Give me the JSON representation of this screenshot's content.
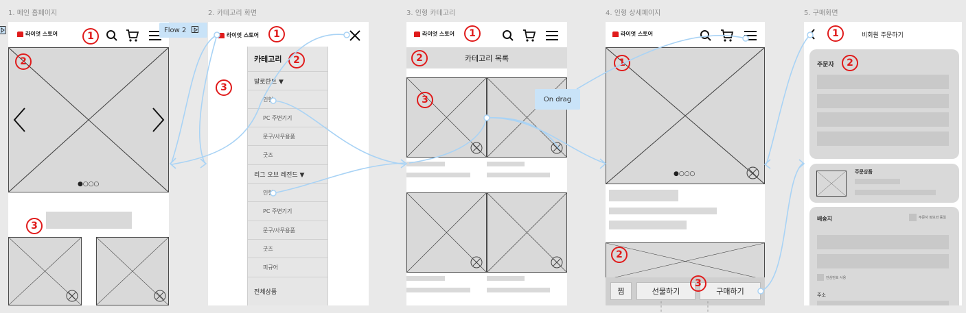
{
  "frames": [
    {
      "title": "1. 메인 홈페이지"
    },
    {
      "title": "2. 카테고리 화면"
    },
    {
      "title": "3. 인형 카테고리"
    },
    {
      "title": "4. 인형 상세페이지"
    },
    {
      "title": "5. 구매화면"
    }
  ],
  "brand": {
    "logo_text": "라이엇 스토어",
    "accent": "#e01b1b",
    "flow_color": "#a9d3f5"
  },
  "flow_label": "Flow 2",
  "drag_label": "On drag",
  "badges": [
    "1",
    "2",
    "3"
  ],
  "category_menu": {
    "header": "카테고리",
    "groups": [
      {
        "label": "발로란트 ▼",
        "items": [
          "인형",
          "PC 주변기기",
          "문구/사무용품",
          "굿즈"
        ]
      },
      {
        "label": "리그 오브 레전드 ▼",
        "items": [
          "인형",
          "PC 주변기기",
          "문구/사무용품",
          "굿즈",
          "피규어"
        ]
      }
    ],
    "all_products": "전체상품"
  },
  "category_list_title": "카테고리 목록",
  "detail_actions": {
    "wish": "찜",
    "gift": "선물하기",
    "buy": "구매하기"
  },
  "checkout": {
    "title": "비회원 주문하기",
    "orderer": "주문자",
    "order_item": "주문상품",
    "shipping": "배송지",
    "same_as_orderer": "주문자 정보와 동일",
    "safe_number": "안심번호 사용",
    "address": "주소"
  },
  "carousel_dots": "●○○○",
  "icons": [
    "search-icon",
    "cart-icon",
    "menu-icon",
    "close-icon",
    "back-icon",
    "chevron-left-icon",
    "chevron-right-icon",
    "play-icon"
  ]
}
